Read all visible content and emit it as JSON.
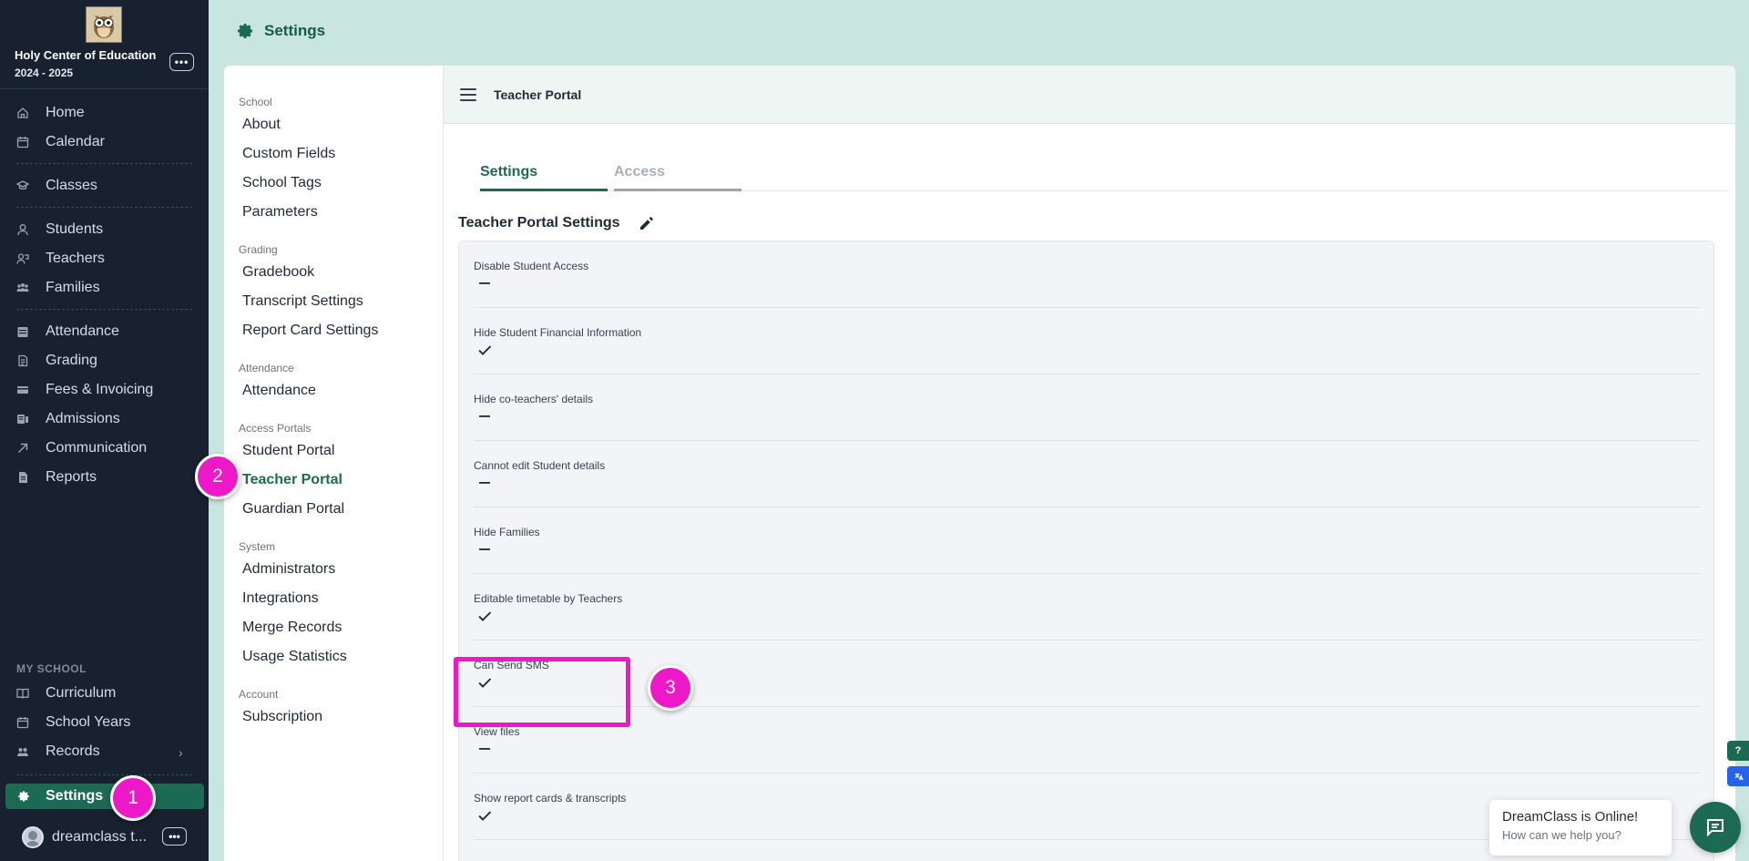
{
  "sidebar": {
    "school_name": "Holy Center of Education",
    "school_year": "2024 - 2025",
    "more_label": "•••",
    "items": [
      {
        "label": "Home",
        "icon": "home-icon"
      },
      {
        "label": "Calendar",
        "icon": "calendar-icon"
      },
      {
        "label": "Classes",
        "icon": "graduation-cap-icon"
      },
      {
        "label": "Students",
        "icon": "student-icon"
      },
      {
        "label": "Teachers",
        "icon": "teacher-icon"
      },
      {
        "label": "Families",
        "icon": "families-icon"
      },
      {
        "label": "Attendance",
        "icon": "attendance-icon"
      },
      {
        "label": "Grading",
        "icon": "grading-icon"
      },
      {
        "label": "Fees & Invoicing",
        "icon": "fees-icon"
      },
      {
        "label": "Admissions",
        "icon": "admissions-icon"
      },
      {
        "label": "Communication",
        "icon": "communication-arrow-icon"
      },
      {
        "label": "Reports",
        "icon": "reports-icon"
      }
    ],
    "my_school_label": "MY SCHOOL",
    "my_school_items": [
      {
        "label": "Curriculum",
        "icon": "book-icon"
      },
      {
        "label": "School Years",
        "icon": "calendar-icon"
      },
      {
        "label": "Records",
        "icon": "records-icon"
      }
    ],
    "settings_label": "Settings",
    "user_name": "dreamclass t...",
    "user_more_label": "•••"
  },
  "header": {
    "title": "Settings"
  },
  "settings_menu": {
    "categories": [
      {
        "label": "School",
        "links": [
          "About",
          "Custom Fields",
          "School Tags",
          "Parameters"
        ]
      },
      {
        "label": "Grading",
        "links": [
          "Gradebook",
          "Transcript Settings",
          "Report Card Settings"
        ]
      },
      {
        "label": "Attendance",
        "links": [
          "Attendance"
        ]
      },
      {
        "label": "Access Portals",
        "links": [
          "Student Portal",
          "Teacher Portal",
          "Guardian Portal"
        ]
      },
      {
        "label": "System",
        "links": [
          "Administrators",
          "Integrations",
          "Merge Records",
          "Usage Statistics"
        ]
      },
      {
        "label": "Account",
        "links": [
          "Subscription"
        ]
      }
    ],
    "active_link": "Teacher Portal"
  },
  "content": {
    "topbar_title": "Teacher Portal",
    "tabs": [
      {
        "label": "Settings",
        "active": true
      },
      {
        "label": "Access",
        "active": false
      }
    ],
    "section_title": "Teacher Portal Settings",
    "settings": [
      {
        "label": "Disable Student Access",
        "enabled": false
      },
      {
        "label": "Hide Student Financial Information",
        "enabled": true
      },
      {
        "label": "Hide co-teachers' details",
        "enabled": false
      },
      {
        "label": "Cannot edit Student details",
        "enabled": false
      },
      {
        "label": "Hide Families",
        "enabled": false
      },
      {
        "label": "Editable timetable by Teachers",
        "enabled": true
      },
      {
        "label": "Can Send SMS",
        "enabled": true
      },
      {
        "label": "View files",
        "enabled": false
      },
      {
        "label": "Show report cards & transcripts",
        "enabled": true
      }
    ]
  },
  "annotations": {
    "markers": [
      "1",
      "2",
      "3"
    ],
    "color": "#ee18c8"
  },
  "chat": {
    "title": "DreamClass is Online!",
    "subtitle": "How can we help you?",
    "help_label": "?"
  },
  "colors": {
    "accent": "#1d6a52",
    "sidebar_bg": "#17212f",
    "page_bg": "#c8e6df"
  }
}
